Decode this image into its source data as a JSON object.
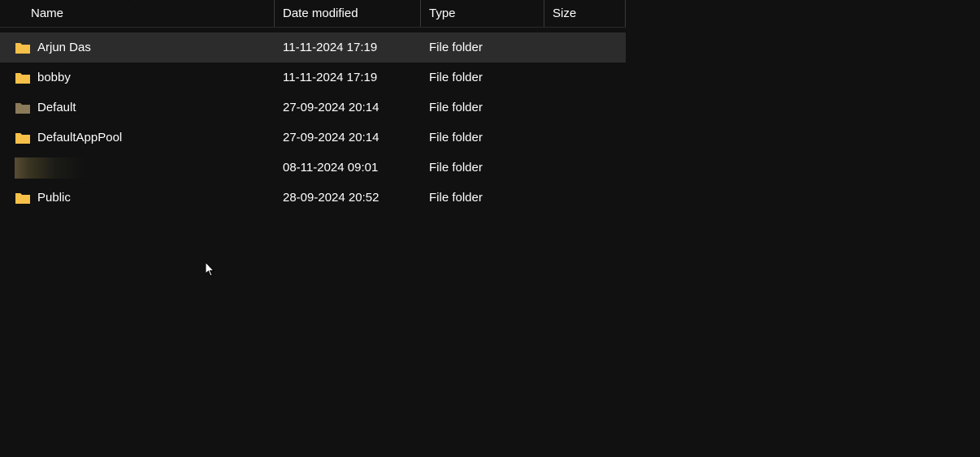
{
  "columns": {
    "name": "Name",
    "date": "Date modified",
    "type": "Type",
    "size": "Size"
  },
  "folder_colors": {
    "normal": "#f7c049",
    "dim": "#8a7a5a"
  },
  "rows": [
    {
      "name": "Arjun Das",
      "date": "11-11-2024 17:19",
      "type": "File folder",
      "size": "",
      "highlight": true,
      "folder_style": "normal",
      "redacted": false
    },
    {
      "name": "bobby",
      "date": "11-11-2024 17:19",
      "type": "File folder",
      "size": "",
      "highlight": false,
      "folder_style": "normal",
      "redacted": false
    },
    {
      "name": "Default",
      "date": "27-09-2024 20:14",
      "type": "File folder",
      "size": "",
      "highlight": false,
      "folder_style": "dim",
      "redacted": false
    },
    {
      "name": "DefaultAppPool",
      "date": "27-09-2024 20:14",
      "type": "File folder",
      "size": "",
      "highlight": false,
      "folder_style": "normal",
      "redacted": false
    },
    {
      "name": "",
      "date": "08-11-2024 09:01",
      "type": "File folder",
      "size": "",
      "highlight": false,
      "folder_style": "normal",
      "redacted": true
    },
    {
      "name": "Public",
      "date": "28-09-2024 20:52",
      "type": "File folder",
      "size": "",
      "highlight": false,
      "folder_style": "normal",
      "redacted": false
    }
  ]
}
